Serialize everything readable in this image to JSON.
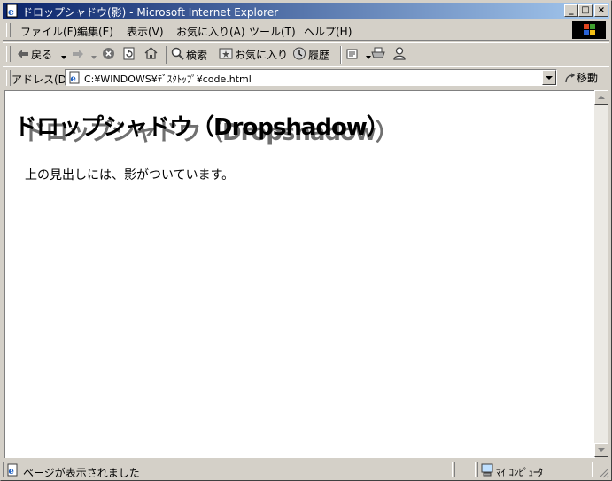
{
  "window": {
    "title": "ドロップシャドウ(影) - Microsoft Internet Explorer",
    "controls": {
      "minimize": "_",
      "maximize": "□",
      "close": "×"
    }
  },
  "menubar": {
    "items": [
      "ファイル(F)",
      "編集(E)",
      "表示(V)",
      "お気に入り(A)",
      "ツール(T)",
      "ヘルプ(H)"
    ]
  },
  "toolbar": {
    "back_label": "戻る",
    "search_label": "検索",
    "favorites_label": "お気に入り",
    "history_label": "履歴"
  },
  "addressbar": {
    "label": "アドレス(D)",
    "url": "C:¥WINDOWS¥ﾃﾞｽｸﾄｯﾌﾟ¥code.html",
    "go_label": "移動"
  },
  "page": {
    "heading": "ドロップシャドウ（Dropshadow）",
    "paragraph": "上の見出しには、影がついています。"
  },
  "statusbar": {
    "status": "ページが表示されました",
    "zone": "ﾏｲ ｺﾝﾋﾟｭｰﾀ"
  },
  "colors": {
    "titlebar_start": "#0a246a",
    "titlebar_end": "#a6caf0",
    "chrome": "#d4d0c8",
    "shadow": "#707070"
  }
}
